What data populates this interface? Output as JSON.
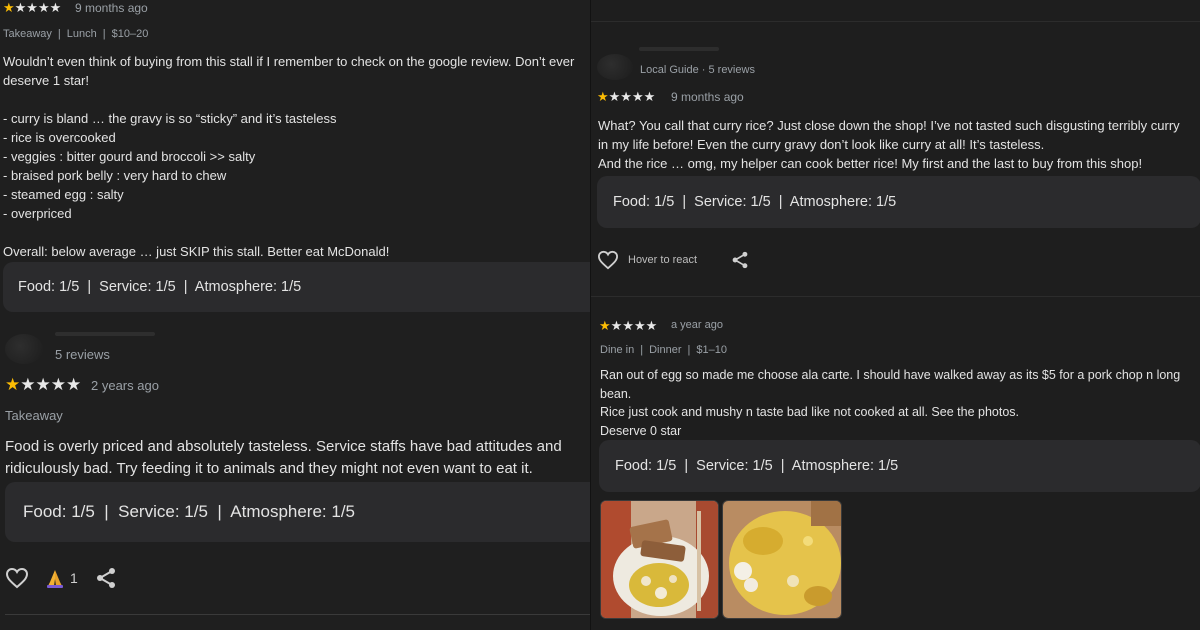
{
  "left": {
    "review1": {
      "stars_label": "★★★★★",
      "time": "9 months ago",
      "meta": [
        "Takeaway",
        "Lunch",
        "$10–20"
      ],
      "sep": "|",
      "text": "Wouldn’t even think of buying from this stall if I remember to check on the google review. Don’t ever\ndeserve 1 star!\n\n- curry is bland … the gravy is so “sticky” and it’s tasteless\n- rice is overcooked\n- veggies : bitter gourd and broccoli >> salty\n- braised pork belly : very hard to chew\n- steamed egg : salty\n- overpriced\n\nOverall: below average … just SKIP this stall. Better eat McDonald!",
      "ratings": "Food: 1/5  |  Service: 1/5  |  Atmosphere: 1/5"
    },
    "review2": {
      "reviewer_stats": "5 reviews",
      "stars_label": "★★★★★",
      "time": "2 years ago",
      "meta": "Takeaway",
      "text": "Food is overly priced and absolutely tasteless. Service staffs have bad attitudes and\nridiculously bad. Try feeding it to animals and they might not even want to eat it.",
      "ratings": "Food: 1/5  |  Service: 1/5  |  Atmosphere: 1/5",
      "reaction_count": "1"
    }
  },
  "right": {
    "review3": {
      "reviewer_stats": "Local Guide · 5 reviews",
      "stars_label": "★★★★★",
      "time": "9 months ago",
      "text": "What? You call that curry rice? Just close down the shop! I’ve not tasted such disgusting terribly curry\nin my life before! Even the curry gravy don’t look like curry at all! It’s tasteless.\nAnd the rice … omg, my helper can cook better rice! My first and the last to buy from this shop!",
      "ratings": "Food: 1/5  |  Service: 1/5  |  Atmosphere: 1/5",
      "react_label": "Hover to react"
    },
    "review4": {
      "stars_label": "★★★★★",
      "time": "a year ago",
      "meta": [
        "Dine in",
        "Dinner",
        "$1–10"
      ],
      "sep": "|",
      "text": "Ran out of egg so made me choose ala carte. I should have walked away as its $5 for a pork chop n long\nbean.\nRice just cook and mushy n taste bad like not cooked at all. See the photos.\nDeserve 0 star",
      "ratings": "Food: 1/5  |  Service: 1/5  |  Atmosphere: 1/5"
    }
  },
  "colors": {
    "background": "#1f1f1f",
    "chip": "#2b2b2d",
    "star_filled": "#fbbc04",
    "star_empty": "#e8e8e8",
    "text": "#e3e3e3",
    "muted": "#9aa0a6"
  }
}
